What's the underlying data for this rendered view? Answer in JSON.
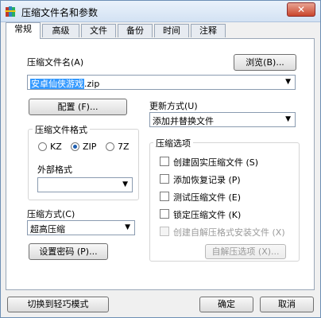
{
  "window": {
    "title": "压缩文件名和参数",
    "close_glyph": "✕",
    "app_icon": "winrar-books-icon"
  },
  "tabs": [
    "常规",
    "高级",
    "文件",
    "备份",
    "时间",
    "注释"
  ],
  "general": {
    "archive_name_label": "压缩文件名(A)",
    "archive_name_selected": "安卓仙侠游戏",
    "archive_name_rest": ".zip",
    "browse_button": "浏览(B)...",
    "profiles_button": "配置 (F)...",
    "update_mode_label": "更新方式(U)",
    "update_mode_value": "添加并替换文件",
    "format_group_title": "压缩文件格式",
    "formats": [
      {
        "label": "KZ",
        "selected": false
      },
      {
        "label": "ZIP",
        "selected": true
      },
      {
        "label": "7Z",
        "selected": false
      }
    ],
    "external_format_label": "外部格式",
    "external_format_value": "",
    "method_label": "压缩方式(C)",
    "method_value": "超高压缩",
    "password_button": "设置密码 (P)...",
    "options_group_title": "压缩选项",
    "options": [
      {
        "label": "创建固实压缩文件 (S)",
        "checked": false,
        "enabled": true
      },
      {
        "label": "添加恢复记录 (P)",
        "checked": false,
        "enabled": true
      },
      {
        "label": "测试压缩文件 (E)",
        "checked": false,
        "enabled": true
      },
      {
        "label": "锁定压缩文件 (K)",
        "checked": false,
        "enabled": true
      },
      {
        "label": "创建自解压格式安装文件 (X)",
        "checked": false,
        "enabled": false
      }
    ],
    "sfx_options_button": "自解压选项 (X)..."
  },
  "footer": {
    "switch_mode_button": "切换到轻巧模式",
    "ok_button": "确定",
    "cancel_button": "取消"
  }
}
